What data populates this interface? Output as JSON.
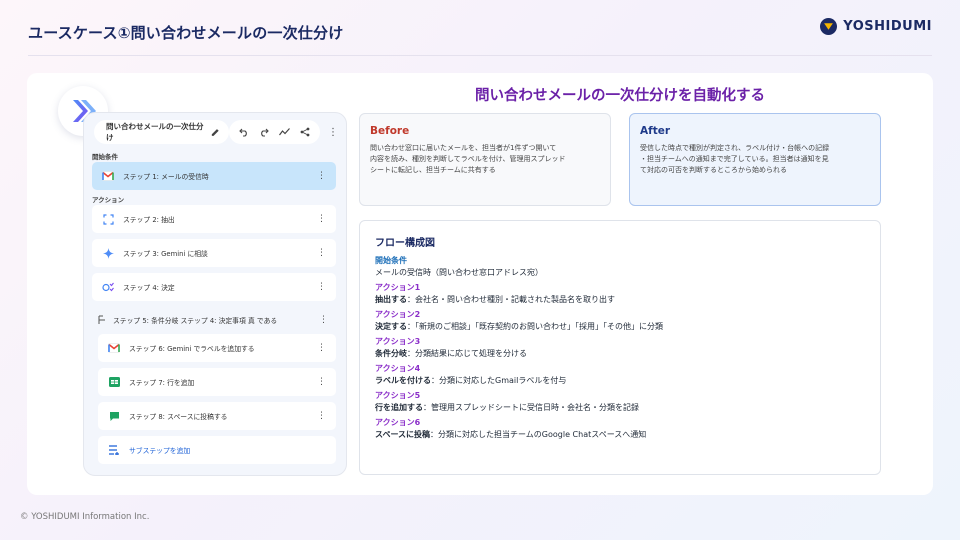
{
  "slide": {
    "title": "ユースケース①問い合わせメールの一次仕分け",
    "brand": "YOSHIDUMI",
    "footer": "© YOSHIDUMI Information Inc."
  },
  "workflow_app": {
    "flow_name": "問い合わせメールの一次仕分け",
    "toolbar_icons": [
      "edit-icon",
      "undo-icon",
      "redo-icon",
      "activity-icon",
      "share-icon",
      "more-icon"
    ],
    "start_label": "開始条件",
    "actions_label": "アクション",
    "steps": [
      {
        "label": "ステップ 1: メールの受信時",
        "icon": "gmail-icon"
      },
      {
        "label": "ステップ 2: 抽出",
        "icon": "extract-icon"
      },
      {
        "label": "ステップ 3: Gemini に相談",
        "icon": "gemini-icon"
      },
      {
        "label": "ステップ 4: 決定",
        "icon": "decide-icon"
      },
      {
        "label": "ステップ 5: 条件分岐 ステップ 4: 決定事項 真 である",
        "icon": "branch-icon"
      },
      {
        "label": "ステップ 6: Gemini でラベルを追加する",
        "icon": "gmail-icon"
      },
      {
        "label": "ステップ 7: 行を追加",
        "icon": "sheets-icon"
      },
      {
        "label": "ステップ 8: スペースに投稿する",
        "icon": "chat-icon"
      },
      {
        "label": "サブステップを追加",
        "icon": "add-substep-icon"
      }
    ],
    "colors": {
      "selected": "#c8e5fb",
      "accent": "#1a5fd6"
    }
  },
  "main": {
    "title": "問い合わせメールの一次仕分けを自動化する",
    "before": {
      "heading": "Before",
      "lines": [
        "問い合わせ窓口に届いたメールを、担当者が1件ずつ開いて",
        "内容を読み、種別を判断してラベルを付け、管理用スプレッド",
        "シートに転記し、担当チームに共有する"
      ]
    },
    "after": {
      "heading": "After",
      "lines": [
        "受信した時点で種別が判定され、ラベル付け・台帳への記録",
        "・担当チームへの通知まで完了している。担当者は通知を見",
        "て対応の可否を判断するところから始められる"
      ]
    },
    "flow": {
      "heading": "フロー構成図",
      "items": [
        {
          "label": "開始条件",
          "title": "",
          "desc": "メールの受信時（問い合わせ窓口アドレス宛）"
        },
        {
          "label": "アクション1",
          "title": "抽出する",
          "desc": "：会社名・問い合わせ種別・記載された製品名を取り出す"
        },
        {
          "label": "アクション2",
          "title": "決定する",
          "desc": "：「新規のご相談」「既存契約のお問い合わせ」「採用」「その他」に分類"
        },
        {
          "label": "アクション3",
          "title": "条件分岐",
          "desc": "：分類結果に応じて処理を分ける"
        },
        {
          "label": "アクション4",
          "title": "ラベルを付ける",
          "desc": "：分類に対応したGmailラベルを付与"
        },
        {
          "label": "アクション5",
          "title": "行を追加する",
          "desc": "：管理用スプレッドシートに受信日時・会社名・分類を記録"
        },
        {
          "label": "アクション6",
          "title": "スペースに投稿",
          "desc": "：分類に対応した担当チームのGoogle Chatスペースへ通知"
        }
      ]
    },
    "colors": {
      "title": "#6b21a8",
      "before": "#c0392b",
      "after": "#1f3a8a",
      "start": "#1d6fb8",
      "action": "#8b2fc9"
    }
  }
}
